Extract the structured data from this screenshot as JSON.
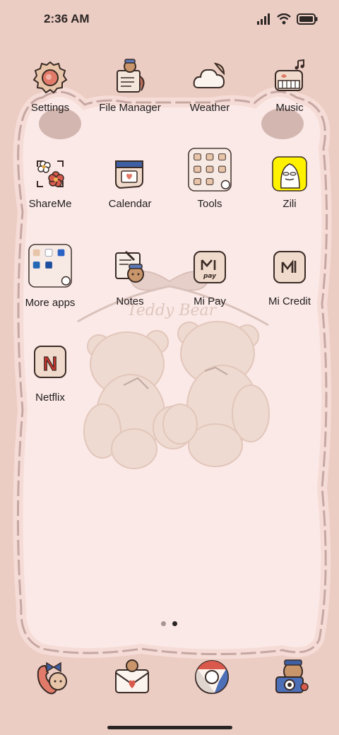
{
  "status": {
    "time": "2:36 AM",
    "icons": [
      "signal-icon",
      "wifi-icon",
      "battery-icon"
    ]
  },
  "wallpaper": {
    "caption": "Teddy Bear"
  },
  "apps": {
    "settings": "Settings",
    "file_manager": "File Manager",
    "weather": "Weather",
    "music": "Music",
    "shareme": "ShareMe",
    "calendar": "Calendar",
    "tools": "Tools",
    "zili": "Zili",
    "more_apps": "More apps",
    "notes": "Notes",
    "mi_pay": "Mi Pay",
    "mi_credit": "Mi Credit",
    "netflix": "Netflix"
  },
  "icon_text": {
    "mi_pay": "pay",
    "netflix": "N"
  },
  "pages": {
    "count": 2,
    "current": 2
  },
  "dock": [
    "phone-bear-icon",
    "messages-envelope-icon",
    "chrome-browser-icon",
    "camera-bear-icon"
  ],
  "colors": {
    "background": "#eccdc4",
    "frame": "#fbe9e7",
    "frame_border": "#b59591",
    "label": "#1f1c1c",
    "icon_fill": "#f0dacb",
    "icon_stroke": "#3a2b26",
    "zili_yellow": "#fff200",
    "netflix_red": "#c9342d"
  }
}
